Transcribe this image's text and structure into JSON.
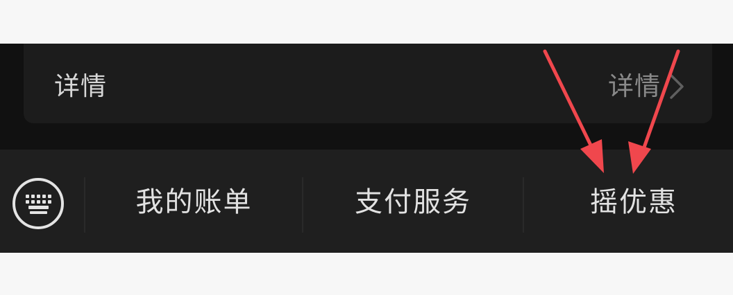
{
  "card": {
    "label": "详情",
    "link_text": "详情",
    "chevron_icon": "chevron-right-icon"
  },
  "tabbar": {
    "keyboard_icon": "keyboard-icon",
    "tabs": [
      {
        "label": "我的账单"
      },
      {
        "label": "支付服务"
      },
      {
        "label": "摇优惠"
      }
    ]
  },
  "annotation": {
    "arrow_color": "#f0474d",
    "arrow_count": 2
  },
  "colors": {
    "background": "#f7f7f7",
    "dark_area": "#111111",
    "card": "#1c1c1c",
    "tabbar": "#1f1f1f",
    "primary_text": "#e2e2e2",
    "secondary_text": "#8a8a8a"
  }
}
